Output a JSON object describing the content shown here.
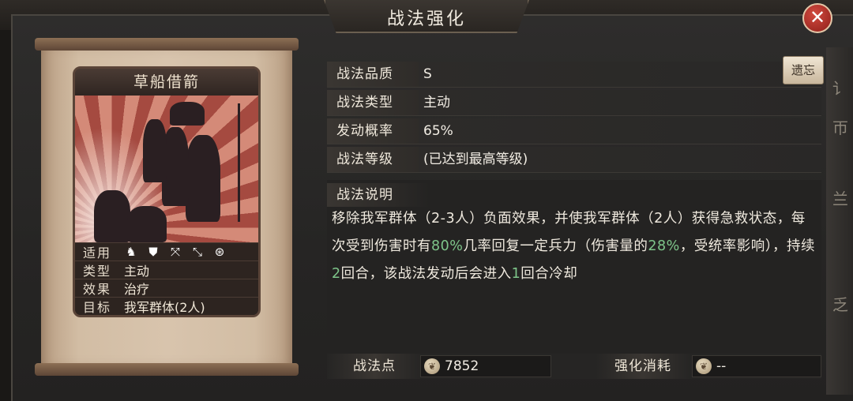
{
  "window": {
    "title": "战法强化"
  },
  "card": {
    "name": "草船借箭",
    "info": [
      {
        "key": "适用",
        "value": ""
      },
      {
        "key": "类型",
        "value": "主动"
      },
      {
        "key": "效果",
        "value": "治疗"
      },
      {
        "key": "目标",
        "value": "我军群体(2人)"
      }
    ],
    "troop_icons": [
      "cavalry-icon",
      "shield-icon",
      "bow-icon",
      "spear-icon",
      "siege-wheel-icon"
    ]
  },
  "attributes": [
    {
      "key": "战法品质",
      "value": "S"
    },
    {
      "key": "战法类型",
      "value": "主动"
    },
    {
      "key": "发动概率",
      "value": "65%"
    },
    {
      "key": "战法等级",
      "value": "(已达到最高等级)"
    }
  ],
  "forget_button": "遗忘",
  "description": {
    "heading": "战法说明",
    "parts": [
      "移除我军群体（2-3人）负面效果，并使我军群体（2人）获得急救状态，每次受到伤害时有",
      "80%",
      "几率回复一定兵力（伤害量的",
      "28%",
      "，受统率影响），持续",
      "2",
      "回合，该战法发动后会进入",
      "1",
      "回合冷却"
    ]
  },
  "points": {
    "label": "战法点",
    "value": "7852",
    "cost_label": "强化消耗",
    "cost_value": "--"
  },
  "side_text": [
    "讠",
    "帀",
    "兰",
    "乏"
  ],
  "colors": {
    "highlight": "#7ec58a",
    "close": "#b8332a"
  }
}
